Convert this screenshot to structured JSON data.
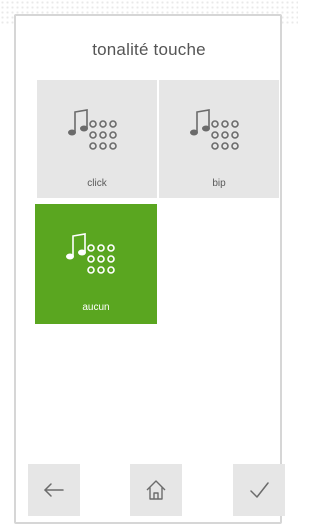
{
  "title": "tonalité touche",
  "options": [
    {
      "label": "click",
      "selected": false,
      "icon": "music-keypad-icon"
    },
    {
      "label": "bip",
      "selected": false,
      "icon": "music-keypad-icon"
    },
    {
      "label": "aucun",
      "selected": true,
      "icon": "music-keypad-icon"
    }
  ],
  "nav": {
    "back_icon": "arrow-left-icon",
    "home_icon": "home-icon",
    "confirm_icon": "checkmark-icon"
  },
  "colors": {
    "selected": "#5aa620",
    "tile": "#e6e6e6",
    "text": "#555555"
  }
}
